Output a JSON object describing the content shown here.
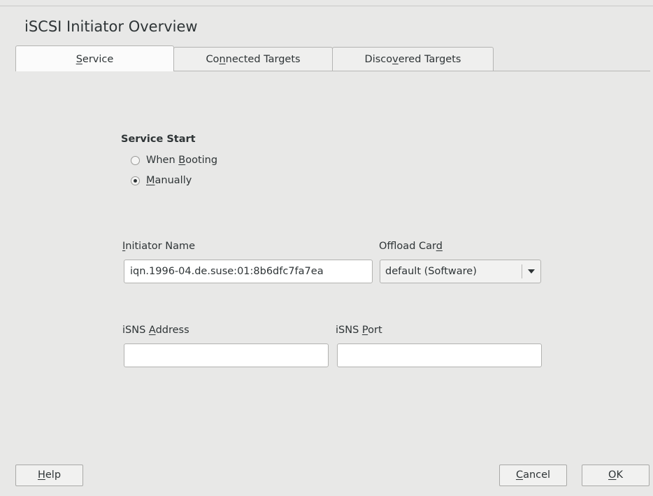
{
  "window": {
    "title": "iSCSI Initiator Overview"
  },
  "tabs": [
    {
      "pre": "",
      "mn": "S",
      "post": "ervice",
      "active": true
    },
    {
      "pre": "Co",
      "mn": "n",
      "post": "nected Targets",
      "active": false
    },
    {
      "pre": "Disco",
      "mn": "v",
      "post": "ered Targets",
      "active": false
    }
  ],
  "service_start": {
    "title": "Service Start",
    "options": [
      {
        "pre": "When ",
        "mn": "B",
        "post": "ooting",
        "checked": false
      },
      {
        "pre": "",
        "mn": "M",
        "post": "anually",
        "checked": true
      }
    ]
  },
  "initiator": {
    "label_mn": "I",
    "label_post": "nitiator Name",
    "value": "iqn.1996-04.de.suse:01:8b6dfc7fa7ea"
  },
  "offload": {
    "label_pre": "Offload Car",
    "label_mn": "d",
    "selected": "default (Software)"
  },
  "isns_address": {
    "label_pre": "iSNS ",
    "label_mn": "A",
    "label_post": "ddress",
    "value": ""
  },
  "isns_port": {
    "label_pre": "iSNS ",
    "label_mn": "P",
    "label_post": "ort",
    "value": ""
  },
  "buttons": {
    "help": {
      "mn": "H",
      "post": "elp"
    },
    "cancel": {
      "mn": "C",
      "post": "ancel"
    },
    "ok": {
      "mn": "O",
      "post": "K"
    }
  }
}
